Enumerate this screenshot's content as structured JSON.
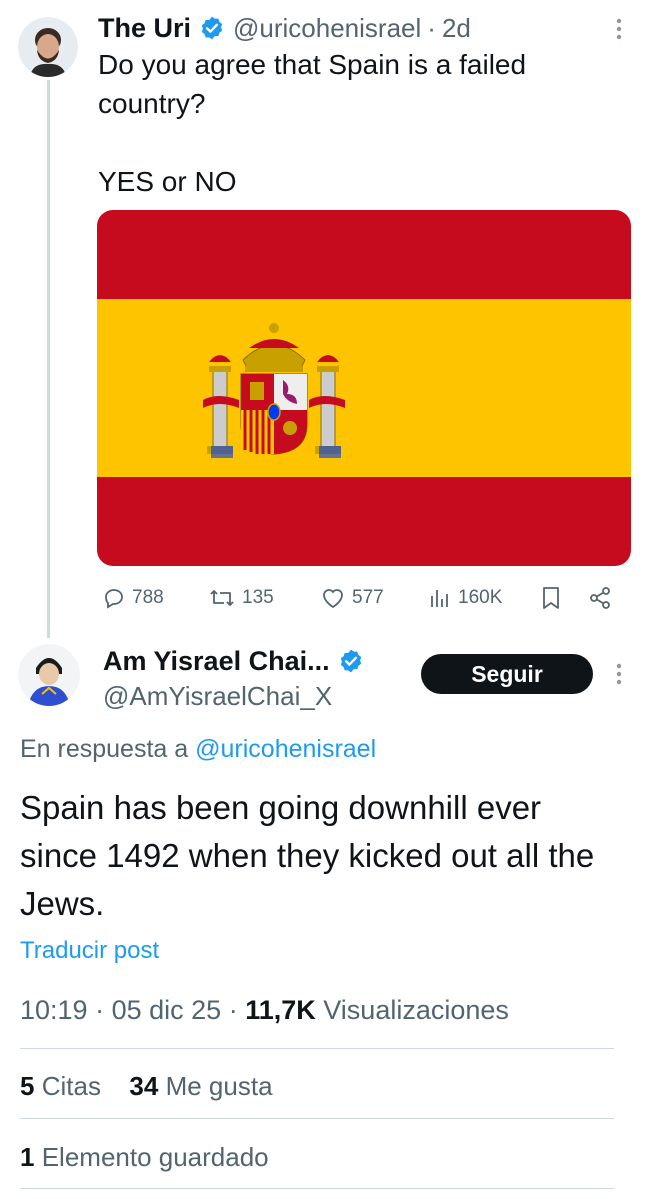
{
  "tweet1": {
    "display_name": "The Uri",
    "handle": "@uricohenisrael",
    "separator": "·",
    "age": "2d",
    "text": "Do you agree that Spain is a failed\ncountry?\n\nYES or NO",
    "image": "spain-flag",
    "counts": {
      "replies": "788",
      "reposts": "135",
      "likes": "577",
      "views": "160K"
    }
  },
  "tweet2": {
    "display_name": "Am Yisrael Chai...",
    "handle": "@AmYisraelChai_X",
    "follow_label": "Seguir",
    "reply_prefix": "En respuesta a",
    "reply_handle": "@uricohenisrael",
    "text": "Spain has been going downhill ever since 1492 when they kicked out all the Jews.",
    "translate_label": "Traducir post",
    "time": "10:19",
    "date": "05 dic 25",
    "views_count": "11,7K",
    "views_label": "Visualizaciones",
    "quotes_count": "5",
    "quotes_label": "Citas",
    "likes_count": "34",
    "likes_label": "Me gusta",
    "bookmarks_count": "1",
    "bookmarks_label": "Elemento guardado"
  },
  "colors": {
    "accent": "#1d9bf0",
    "secondary_text": "#536471",
    "flag_red": "#c60b1e",
    "flag_yellow": "#ffc400"
  }
}
